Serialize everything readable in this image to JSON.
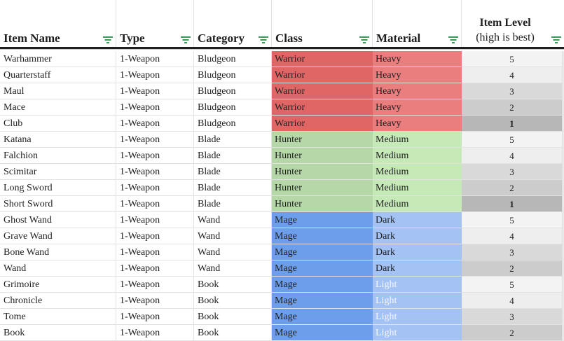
{
  "headers": {
    "item_name": "Item Name",
    "type": "Type",
    "category": "Category",
    "class": "Class",
    "material": "Material",
    "item_level_title": "Item Level",
    "item_level_subtitle": "(high is best)"
  },
  "filter_icon": "filter-icon",
  "colors": {
    "warrior_class": "#e06666",
    "warrior_material": "#ea7d7d",
    "hunter_class": "#b6d7a8",
    "hunter_material": "#c6e9b8",
    "mage_class": "#6d9eeb",
    "mage_material": "#a4c2f4",
    "level_5": "#f3f3f3",
    "level_4": "#eeeeee",
    "level_3": "#d9d9d9",
    "level_2": "#cccccc",
    "level_1": "#b7b7b7",
    "light_text": "#f3f7ff"
  },
  "rows": [
    {
      "name": "Warhammer",
      "type": "1-Weapon",
      "category": "Bludgeon",
      "class": "Warrior",
      "material": "Heavy",
      "level": "5"
    },
    {
      "name": "Quarterstaff",
      "type": "1-Weapon",
      "category": "Bludgeon",
      "class": "Warrior",
      "material": "Heavy",
      "level": "4"
    },
    {
      "name": "Maul",
      "type": "1-Weapon",
      "category": "Bludgeon",
      "class": "Warrior",
      "material": "Heavy",
      "level": "3"
    },
    {
      "name": "Mace",
      "type": "1-Weapon",
      "category": "Bludgeon",
      "class": "Warrior",
      "material": "Heavy",
      "level": "2"
    },
    {
      "name": "Club",
      "type": "1-Weapon",
      "category": "Bludgeon",
      "class": "Warrior",
      "material": "Heavy",
      "level": "1"
    },
    {
      "name": "Katana",
      "type": "1-Weapon",
      "category": "Blade",
      "class": "Hunter",
      "material": "Medium",
      "level": "5"
    },
    {
      "name": "Falchion",
      "type": "1-Weapon",
      "category": "Blade",
      "class": "Hunter",
      "material": "Medium",
      "level": "4"
    },
    {
      "name": "Scimitar",
      "type": "1-Weapon",
      "category": "Blade",
      "class": "Hunter",
      "material": "Medium",
      "level": "3"
    },
    {
      "name": "Long Sword",
      "type": "1-Weapon",
      "category": "Blade",
      "class": "Hunter",
      "material": "Medium",
      "level": "2"
    },
    {
      "name": "Short Sword",
      "type": "1-Weapon",
      "category": "Blade",
      "class": "Hunter",
      "material": "Medium",
      "level": "1"
    },
    {
      "name": "Ghost Wand",
      "type": "1-Weapon",
      "category": "Wand",
      "class": "Mage",
      "material": "Dark",
      "level": "5"
    },
    {
      "name": "Grave Wand",
      "type": "1-Weapon",
      "category": "Wand",
      "class": "Mage",
      "material": "Dark",
      "level": "4"
    },
    {
      "name": "Bone Wand",
      "type": "1-Weapon",
      "category": "Wand",
      "class": "Mage",
      "material": "Dark",
      "level": "3"
    },
    {
      "name": "Wand",
      "type": "1-Weapon",
      "category": "Wand",
      "class": "Mage",
      "material": "Dark",
      "level": "2"
    },
    {
      "name": "Grimoire",
      "type": "1-Weapon",
      "category": "Book",
      "class": "Mage",
      "material": "Light",
      "level": "5"
    },
    {
      "name": "Chronicle",
      "type": "1-Weapon",
      "category": "Book",
      "class": "Mage",
      "material": "Light",
      "level": "4"
    },
    {
      "name": "Tome",
      "type": "1-Weapon",
      "category": "Book",
      "class": "Mage",
      "material": "Light",
      "level": "3"
    },
    {
      "name": "Book",
      "type": "1-Weapon",
      "category": "Book",
      "class": "Mage",
      "material": "Light",
      "level": "2"
    }
  ]
}
